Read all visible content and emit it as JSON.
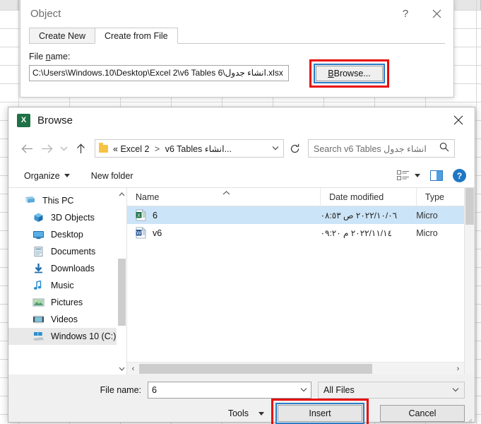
{
  "object_dialog": {
    "title": "Object",
    "help_label": "?",
    "close_label": "✕",
    "tabs": [
      {
        "label": "Create New",
        "active": false
      },
      {
        "label": "Create from File",
        "active": true
      }
    ],
    "file_name_label_pre": "File ",
    "file_name_label_underlined": "n",
    "file_name_label_post": "ame:",
    "file_path_value": "C:\\Users\\Windows.10\\Desktop\\Excel 2\\v6 Tables انشاء جدول\\6.xlsx",
    "browse_button": "Browse...",
    "highlight_color": "#e8090c"
  },
  "browse_dialog": {
    "title": "Browse",
    "app_icon_letter": "X",
    "close_label": "✕",
    "nav": {
      "back_icon": "←",
      "forward_icon": "→",
      "recent_icon": "⌄",
      "up_icon": "↑",
      "refresh_icon": "↻",
      "breadcrumb_prefix": "«",
      "breadcrumb_parts": [
        "Excel 2",
        "v6 Tables انشاء..."
      ],
      "breadcrumb_separator": ">",
      "dropdown_icon": "⌄",
      "search_placeholder": "Search v6 Tables انشاء جدول",
      "search_icon": "⌕"
    },
    "toolbar": {
      "organize": "Organize",
      "new_folder": "New folder",
      "view_icon": "list-view-icon",
      "pane_icon": "preview-pane-icon",
      "help_icon": "?"
    },
    "sidebar": {
      "items": [
        {
          "label": "This PC",
          "icon": "computer-icon",
          "indent": false,
          "selected": false
        },
        {
          "label": "3D Objects",
          "icon": "3d-objects-icon",
          "indent": true,
          "selected": false
        },
        {
          "label": "Desktop",
          "icon": "desktop-icon",
          "indent": true,
          "selected": false
        },
        {
          "label": "Documents",
          "icon": "documents-icon",
          "indent": true,
          "selected": false
        },
        {
          "label": "Downloads",
          "icon": "downloads-icon",
          "indent": true,
          "selected": false
        },
        {
          "label": "Music",
          "icon": "music-icon",
          "indent": true,
          "selected": false
        },
        {
          "label": "Pictures",
          "icon": "pictures-icon",
          "indent": true,
          "selected": false
        },
        {
          "label": "Videos",
          "icon": "videos-icon",
          "indent": true,
          "selected": false
        },
        {
          "label": "Windows 10 (C:)",
          "icon": "drive-icon",
          "indent": true,
          "selected": true
        }
      ],
      "scroll_up_icon": "⌃",
      "scroll_down_icon": "⌄"
    },
    "file_list": {
      "columns": [
        "Name",
        "Date modified",
        "Type"
      ],
      "sort_indicator": "⌃",
      "rows": [
        {
          "name": "6",
          "date_modified": "٢٠٢٢/١٠/٠٦ ص ٠٨:٥٣",
          "type": "Micro",
          "icon": "excel-file-icon",
          "selected": true
        },
        {
          "name": "v6",
          "date_modified": "٢٠٢٢/١١/١٤ م ٠٩:٢٠",
          "type": "Micro",
          "icon": "word-file-icon",
          "selected": false
        }
      ],
      "hscroll_left_icon": "‹",
      "hscroll_right_icon": "›"
    },
    "footer": {
      "file_name_label": "File name:",
      "file_name_value": "6",
      "file_name_caret": "⌄",
      "filter_value": "All Files",
      "filter_caret": "⌄",
      "tools_label": "Tools",
      "tools_caret": "▼",
      "insert_button": "Insert",
      "cancel_button": "Cancel",
      "highlight_color": "#e8090c"
    }
  }
}
